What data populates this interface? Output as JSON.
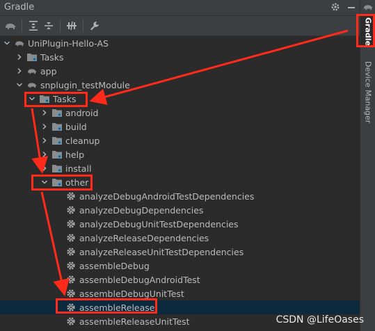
{
  "window": {
    "title": "Gradle"
  },
  "toolbar": {
    "buttons": [
      "elephant-icon",
      "expand-all-icon",
      "collapse-all-icon",
      "toggle-offline-icon",
      "wrench-icon"
    ]
  },
  "tree": [
    {
      "label": "UniPlugin-Hello-AS",
      "depth": 0,
      "chevron": "down",
      "icon": "elephant"
    },
    {
      "label": "Tasks",
      "depth": 1,
      "chevron": "right",
      "icon": "folder-gear"
    },
    {
      "label": "app",
      "depth": 1,
      "chevron": "right",
      "icon": "elephant"
    },
    {
      "label": "snplugin_testModule",
      "depth": 1,
      "chevron": "down",
      "icon": "elephant"
    },
    {
      "label": "Tasks",
      "depth": 2,
      "chevron": "down",
      "icon": "folder-gear"
    },
    {
      "label": "android",
      "depth": 3,
      "chevron": "right",
      "icon": "folder-gear"
    },
    {
      "label": "build",
      "depth": 3,
      "chevron": "right",
      "icon": "folder-gear"
    },
    {
      "label": "cleanup",
      "depth": 3,
      "chevron": "right",
      "icon": "folder-gear"
    },
    {
      "label": "help",
      "depth": 3,
      "chevron": "right",
      "icon": "folder-gear"
    },
    {
      "label": "install",
      "depth": 3,
      "chevron": "right",
      "icon": "folder-gear"
    },
    {
      "label": "other",
      "depth": 3,
      "chevron": "down",
      "icon": "folder-gear"
    },
    {
      "label": "analyzeDebugAndroidTestDependencies",
      "depth": 4,
      "chevron": "",
      "icon": "gear"
    },
    {
      "label": "analyzeDebugDependencies",
      "depth": 4,
      "chevron": "",
      "icon": "gear"
    },
    {
      "label": "analyzeDebugUnitTestDependencies",
      "depth": 4,
      "chevron": "",
      "icon": "gear"
    },
    {
      "label": "analyzeReleaseDependencies",
      "depth": 4,
      "chevron": "",
      "icon": "gear"
    },
    {
      "label": "analyzeReleaseUnitTestDependencies",
      "depth": 4,
      "chevron": "",
      "icon": "gear"
    },
    {
      "label": "assembleDebug",
      "depth": 4,
      "chevron": "",
      "icon": "gear"
    },
    {
      "label": "assembleDebugAndroidTest",
      "depth": 4,
      "chevron": "",
      "icon": "gear"
    },
    {
      "label": "assembleDebugUnitTest",
      "depth": 4,
      "chevron": "",
      "icon": "gear"
    },
    {
      "label": "assembleRelease",
      "depth": 4,
      "chevron": "",
      "icon": "gear",
      "selected": true
    },
    {
      "label": "assembleReleaseUnitTest",
      "depth": 4,
      "chevron": "",
      "icon": "gear"
    }
  ],
  "side_tabs": {
    "gradle": "Gradle",
    "device_manager": "Device Manager"
  },
  "watermark": "CSDN @LifeOases",
  "colors": {
    "background": "#2b2b2b",
    "selection": "#0d293e",
    "highlight": "#ff2a1a"
  }
}
